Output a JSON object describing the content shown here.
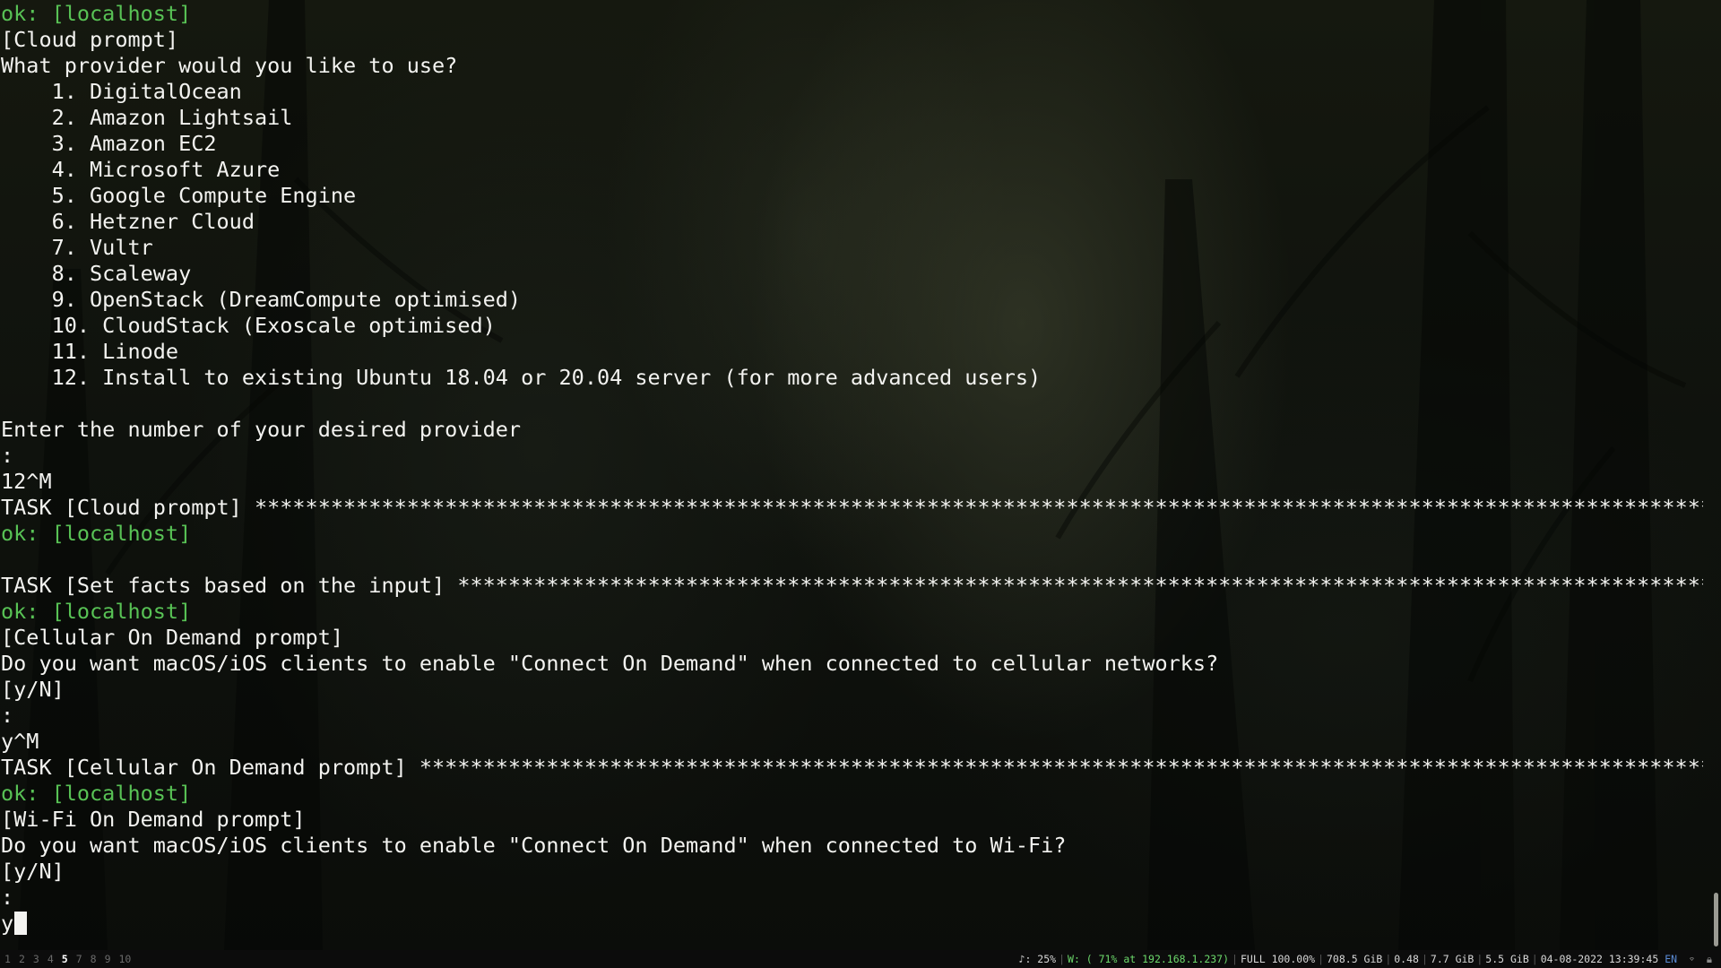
{
  "terminal": {
    "lines": [
      {
        "text": "ok: [localhost]",
        "kind": "ok"
      },
      {
        "text": "[Cloud prompt]",
        "kind": "normal"
      },
      {
        "text": "What provider would you like to use?",
        "kind": "normal"
      },
      {
        "text": "    1. DigitalOcean",
        "kind": "normal"
      },
      {
        "text": "    2. Amazon Lightsail",
        "kind": "normal"
      },
      {
        "text": "    3. Amazon EC2",
        "kind": "normal"
      },
      {
        "text": "    4. Microsoft Azure",
        "kind": "normal"
      },
      {
        "text": "    5. Google Compute Engine",
        "kind": "normal"
      },
      {
        "text": "    6. Hetzner Cloud",
        "kind": "normal"
      },
      {
        "text": "    7. Vultr",
        "kind": "normal"
      },
      {
        "text": "    8. Scaleway",
        "kind": "normal"
      },
      {
        "text": "    9. OpenStack (DreamCompute optimised)",
        "kind": "normal"
      },
      {
        "text": "    10. CloudStack (Exoscale optimised)",
        "kind": "normal"
      },
      {
        "text": "    11. Linode",
        "kind": "normal"
      },
      {
        "text": "    12. Install to existing Ubuntu 18.04 or 20.04 server (for more advanced users)",
        "kind": "normal"
      },
      {
        "text": "",
        "kind": "normal"
      },
      {
        "text": "Enter the number of your desired provider",
        "kind": "normal"
      },
      {
        "text": ":",
        "kind": "normal"
      },
      {
        "text": "12^M",
        "kind": "normal"
      },
      {
        "text": "TASK [Cloud prompt] ",
        "kind": "task"
      },
      {
        "text": "ok: [localhost]",
        "kind": "ok"
      },
      {
        "text": "",
        "kind": "normal"
      },
      {
        "text": "TASK [Set facts based on the input] ",
        "kind": "task"
      },
      {
        "text": "ok: [localhost]",
        "kind": "ok"
      },
      {
        "text": "[Cellular On Demand prompt]",
        "kind": "normal"
      },
      {
        "text": "Do you want macOS/iOS clients to enable \"Connect On Demand\" when connected to cellular networks?",
        "kind": "normal"
      },
      {
        "text": "[y/N]",
        "kind": "normal"
      },
      {
        "text": ":",
        "kind": "normal"
      },
      {
        "text": "y^M",
        "kind": "normal"
      },
      {
        "text": "TASK [Cellular On Demand prompt] ",
        "kind": "task"
      },
      {
        "text": "ok: [localhost]",
        "kind": "ok"
      },
      {
        "text": "[Wi-Fi On Demand prompt]",
        "kind": "normal"
      },
      {
        "text": "Do you want macOS/iOS clients to enable \"Connect On Demand\" when connected to Wi-Fi?",
        "kind": "normal"
      },
      {
        "text": "[y/N]",
        "kind": "normal"
      },
      {
        "text": ":",
        "kind": "normal"
      },
      {
        "text": "y",
        "kind": "input"
      }
    ],
    "star_fill": "****************************************************************************************************************************************************************",
    "colors": {
      "text": "#f3f3f0",
      "ok": "#58c255"
    }
  },
  "statusbar": {
    "workspaces": [
      "1",
      "2",
      "3",
      "4",
      "5",
      "7",
      "8",
      "9",
      "10"
    ],
    "active_workspace": "5",
    "volume": "♪: 25%",
    "wifi": "W: ( 71% at 192.168.1.237)",
    "battery": "FULL 100.00%",
    "disk": "708.5 GiB",
    "load": "0.48",
    "mem_free": "7.7 GiB",
    "mem_used": "5.5 GiB",
    "datetime": "04-08-2022 13:39:45",
    "lang": "EN",
    "tray_icons": [
      "wifi-icon",
      "lock-icon"
    ]
  }
}
